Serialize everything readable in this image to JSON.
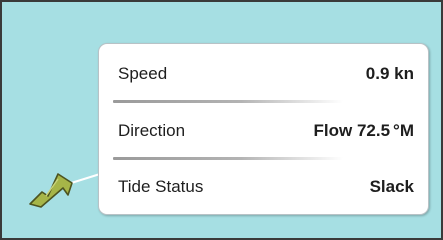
{
  "panel": {
    "rows": [
      {
        "label": "Speed",
        "value": "0.9 kn"
      },
      {
        "label": "Direction",
        "value": "Flow 72.5",
        "unit": "°M"
      },
      {
        "label": "Tide Status",
        "value": "Slack"
      }
    ]
  },
  "colors": {
    "background": "#a6dfe3",
    "card": "#ffffff",
    "arrow": "#a6b548"
  },
  "icons": {
    "pointer": "pointer-arrow-icon"
  }
}
